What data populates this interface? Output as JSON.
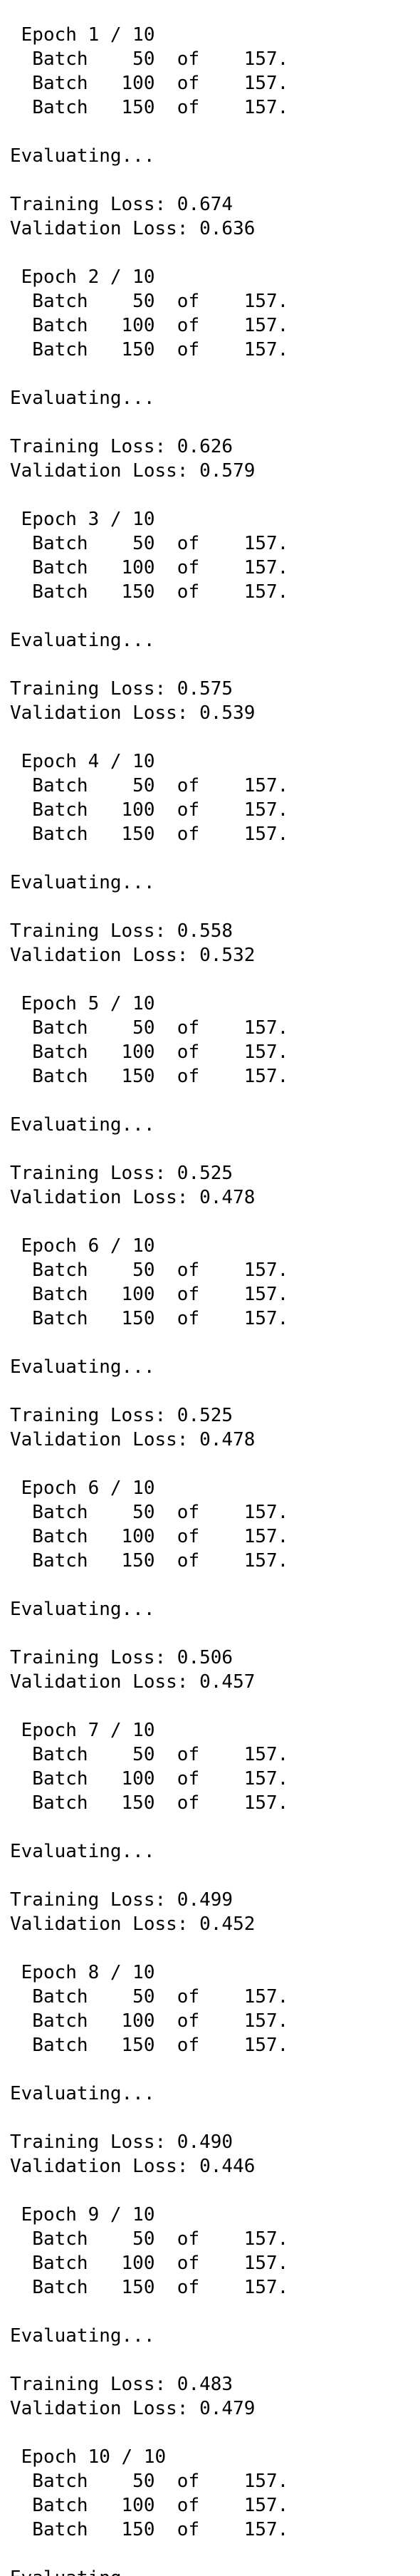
{
  "output": [
    " Epoch 1 / 10",
    "  Batch    50  of    157.",
    "  Batch   100  of    157.",
    "  Batch   150  of    157.",
    "",
    "Evaluating...",
    "",
    "Training Loss: 0.674",
    "Validation Loss: 0.636",
    "",
    " Epoch 2 / 10",
    "  Batch    50  of    157.",
    "  Batch   100  of    157.",
    "  Batch   150  of    157.",
    "",
    "Evaluating...",
    "",
    "Training Loss: 0.626",
    "Validation Loss: 0.579",
    "",
    " Epoch 3 / 10",
    "  Batch    50  of    157.",
    "  Batch   100  of    157.",
    "  Batch   150  of    157.",
    "",
    "Evaluating...",
    "",
    "Training Loss: 0.575",
    "Validation Loss: 0.539",
    "",
    " Epoch 4 / 10",
    "  Batch    50  of    157.",
    "  Batch   100  of    157.",
    "  Batch   150  of    157.",
    "",
    "Evaluating...",
    "",
    "Training Loss: 0.558",
    "Validation Loss: 0.532",
    "",
    " Epoch 5 / 10",
    "  Batch    50  of    157.",
    "  Batch   100  of    157.",
    "  Batch   150  of    157.",
    "",
    "Evaluating...",
    "",
    "Training Loss: 0.525",
    "Validation Loss: 0.478",
    "",
    " Epoch 6 / 10",
    "  Batch    50  of    157.",
    "  Batch   100  of    157.",
    "  Batch   150  of    157.",
    "",
    "Evaluating...",
    "",
    "Training Loss: 0.525",
    "Validation Loss: 0.478",
    "",
    " Epoch 6 / 10",
    "  Batch    50  of    157.",
    "  Batch   100  of    157.",
    "  Batch   150  of    157.",
    "",
    "Evaluating...",
    "",
    "Training Loss: 0.506",
    "Validation Loss: 0.457",
    "",
    " Epoch 7 / 10",
    "  Batch    50  of    157.",
    "  Batch   100  of    157.",
    "  Batch   150  of    157.",
    "",
    "Evaluating...",
    "",
    "Training Loss: 0.499",
    "Validation Loss: 0.452",
    "",
    " Epoch 8 / 10",
    "  Batch    50  of    157.",
    "  Batch   100  of    157.",
    "  Batch   150  of    157.",
    "",
    "Evaluating...",
    "",
    "Training Loss: 0.490",
    "Validation Loss: 0.446",
    "",
    " Epoch 9 / 10",
    "  Batch    50  of    157.",
    "  Batch   100  of    157.",
    "  Batch   150  of    157.",
    "",
    "Evaluating...",
    "",
    "Training Loss: 0.483",
    "Validation Loss: 0.479",
    "",
    " Epoch 10 / 10",
    "  Batch    50  of    157.",
    "  Batch   100  of    157.",
    "  Batch   150  of    157.",
    "",
    "Evaluating..."
  ]
}
